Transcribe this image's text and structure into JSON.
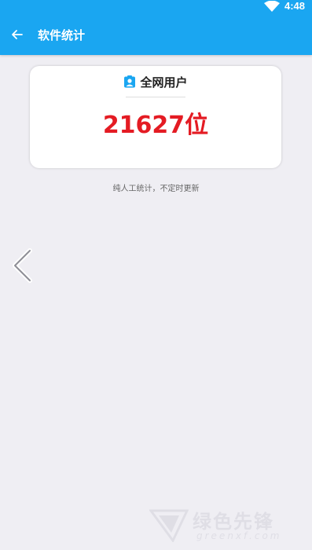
{
  "status_bar": {
    "time": "4:48",
    "icons": [
      "wifi-icon"
    ]
  },
  "app_bar": {
    "title": "软件统计",
    "back_icon": "arrow-left-icon"
  },
  "card": {
    "icon": "user-badge-icon",
    "title": "全网用户",
    "count": "21627位"
  },
  "note": "纯人工统计，不定时更新",
  "watermark": {
    "text": "绿色先锋",
    "sub": "greenxf.com"
  },
  "colors": {
    "app_bar": "#1aa6f1",
    "background": "#efeef3",
    "count": "#e41b23"
  }
}
